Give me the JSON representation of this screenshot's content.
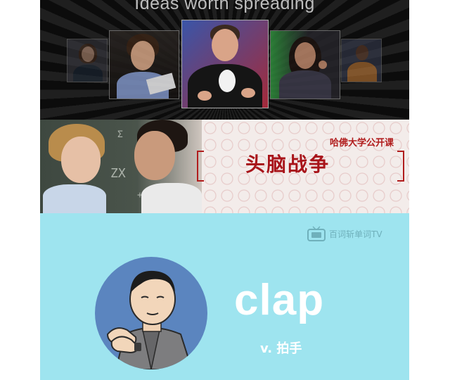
{
  "ted_banner": {
    "tagline": "Ideas worth spreading",
    "speakers": [
      {
        "icon": "speaker-photo-1"
      },
      {
        "icon": "speaker-photo-2"
      },
      {
        "icon": "speaker-photo-3"
      },
      {
        "icon": "speaker-photo-4"
      },
      {
        "icon": "speaker-photo-5"
      }
    ]
  },
  "harvard_banner": {
    "course_label": "哈佛大学公开课",
    "course_title": "头脑战争",
    "chalk_lines": [
      "Σ",
      "ZX",
      "+"
    ]
  },
  "word_card": {
    "watermark": "百词斩单词TV",
    "word": "clap",
    "definition": "v. 拍手",
    "colors": {
      "background": "#9ee4ef",
      "circle": "#5b85bf",
      "word": "#ffffff"
    }
  }
}
